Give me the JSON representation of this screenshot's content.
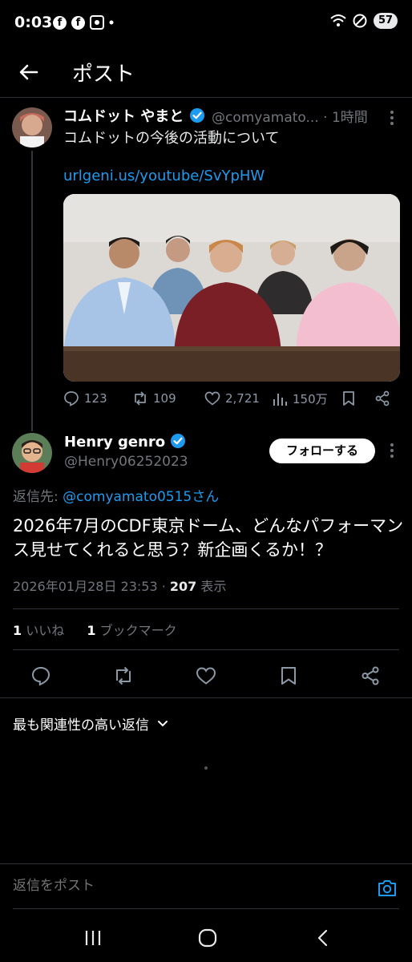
{
  "status_bar": {
    "time": "0:03",
    "fb1": "f",
    "fb2": "f",
    "battery": "57"
  },
  "header": {
    "title": "ポスト"
  },
  "parent_post": {
    "author_name": "コムドット やまと",
    "handle": "@comyamato...",
    "time": "· 1時間",
    "text": "コムドットの今後の活動について",
    "link": "urlgeni.us/youtube/SvYpHW",
    "actions": {
      "replies": "123",
      "reposts": "109",
      "likes": "2,721",
      "views": "150万"
    }
  },
  "reply_post": {
    "author_name": "Henry genro",
    "handle": "@Henry06252023",
    "follow_label": "フォローする",
    "reply_to_prefix": "返信先: ",
    "reply_to_handle": "@comyamato0515さん",
    "text": "2026年7月のCDF東京ドーム、どんなパフォーマンス見せてくれると思う？新企画くるか！？",
    "date": "2026年01月28日 23:53 · ",
    "views_count": "207",
    "views_label": " 表示",
    "likes_count": "1",
    "likes_label": " いいね",
    "bookmarks_count": "1",
    "bookmarks_label": " ブックマーク"
  },
  "sort": {
    "label": "最も関連性の高い返信"
  },
  "compose": {
    "placeholder": "返信をポスト"
  },
  "colors": {
    "accent": "#1d9bf0",
    "background": "#000000",
    "muted": "#71767b"
  }
}
